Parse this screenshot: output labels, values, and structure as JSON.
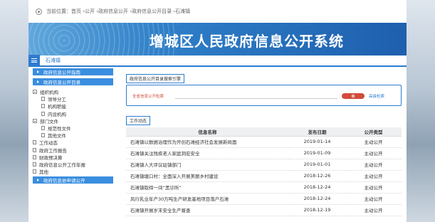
{
  "breadcrumb": {
    "text": "当前位置：首页 ›公开 ›政府信息公开 ›政府信息公开目录 ›石滩镇"
  },
  "banner": {
    "title": "增城区人民政府信息公开系统"
  },
  "nav": {
    "town": "石滩镇"
  },
  "sidebar": {
    "guide": "政府信息公开指南",
    "catalog": "政府信息公开目录",
    "tree": [
      {
        "label": "组织机构",
        "level": 0,
        "icon": "minus-box"
      },
      {
        "label": "领导分工",
        "level": 1,
        "icon": "doc"
      },
      {
        "label": "机构职能",
        "level": 1,
        "icon": "doc"
      },
      {
        "label": "内设机构",
        "level": 1,
        "icon": "doc"
      },
      {
        "label": "部门文件",
        "level": 0,
        "icon": "minus-box"
      },
      {
        "label": "规范性文件",
        "level": 1,
        "icon": "doc"
      },
      {
        "label": "其他文件",
        "level": 1,
        "icon": "doc"
      },
      {
        "label": "工作动态",
        "level": 0,
        "icon": "doc"
      },
      {
        "label": "政府工作报告",
        "level": 0,
        "icon": "doc"
      },
      {
        "label": "财政预决算",
        "level": 0,
        "icon": "doc"
      },
      {
        "label": "政府信息公开工作年报",
        "level": 0,
        "icon": "doc"
      },
      {
        "label": "其他",
        "level": 0,
        "icon": "doc"
      }
    ],
    "apply": "政府信息依申请公开"
  },
  "search": {
    "panel_title": "政府信息公开目录搜索引擎",
    "label": "全省信息公开检索",
    "advanced": "高级检索"
  },
  "work": {
    "panel_title": "工作动态",
    "headers": [
      "信息名称",
      "发布日期",
      "公开类型"
    ],
    "rows": [
      [
        "石滩镇以数据治理作为开创石滩经济社会发展新局面",
        "2019-01-14",
        "主动公开"
      ],
      [
        "石滩镇关注残疾老人家庭洞宏安全",
        "2019-01-09",
        "主动公开"
      ],
      [
        "石滩镇人大评议驻镇部门",
        "2019-01-01",
        "主动公开"
      ],
      [
        "石滩镇塘口村：全面深入开展美丽乡村建设",
        "2018-12-26",
        "主动公开"
      ],
      [
        "石滩镇取缔一间“黑诊所”",
        "2018-12-24",
        "主动公开"
      ],
      [
        "风行乳业年产30万吨生产研发基地项目落户石滩",
        "2018-12-24",
        "主动公开"
      ],
      [
        "石滩镇开展岁末安全生产督查",
        "2018-12-19",
        "主动公开"
      ]
    ]
  }
}
